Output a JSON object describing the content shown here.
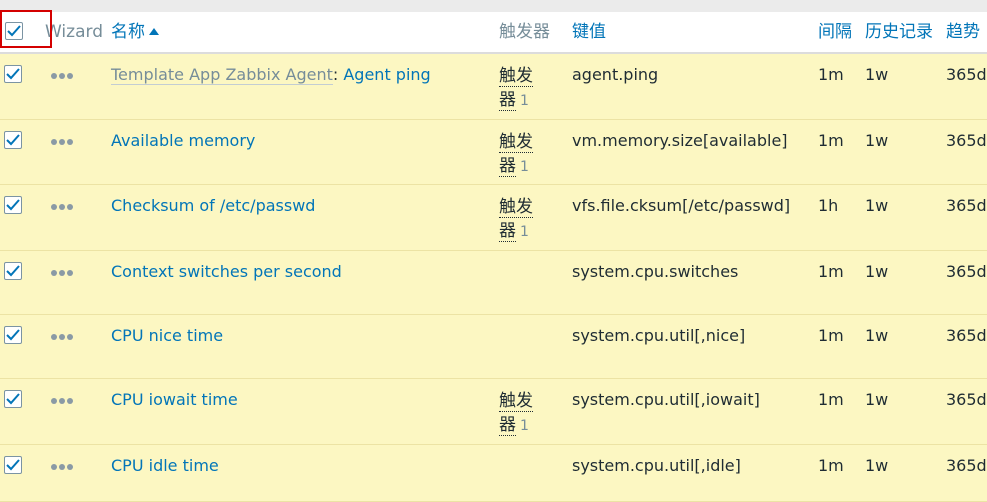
{
  "header": {
    "wizard": "Wizard",
    "name": "名称",
    "triggers": "触发器",
    "key": "键值",
    "interval": "间隔",
    "history": "历史记录",
    "trends": "趋势"
  },
  "rows": [
    {
      "template": "Template App Zabbix Agent",
      "separator": ":",
      "name": "Agent ping",
      "trigger_line1": "触发",
      "trigger_line2": "器",
      "trigger_count": "1",
      "key": "agent.ping",
      "interval": "1m",
      "history": "1w",
      "trends": "365d"
    },
    {
      "template": "",
      "separator": "",
      "name": "Available memory",
      "trigger_line1": "触发",
      "trigger_line2": "器",
      "trigger_count": "1",
      "key": "vm.memory.size[available]",
      "interval": "1m",
      "history": "1w",
      "trends": "365d"
    },
    {
      "template": "",
      "separator": "",
      "name": "Checksum of /etc/passwd",
      "trigger_line1": "触发",
      "trigger_line2": "器",
      "trigger_count": "1",
      "key": "vfs.file.cksum[/etc/passwd]",
      "interval": "1h",
      "history": "1w",
      "trends": "365d"
    },
    {
      "template": "",
      "separator": "",
      "name": "Context switches per second",
      "trigger_line1": "",
      "trigger_line2": "",
      "trigger_count": "",
      "key": "system.cpu.switches",
      "interval": "1m",
      "history": "1w",
      "trends": "365d"
    },
    {
      "template": "",
      "separator": "",
      "name": "CPU nice time",
      "trigger_line1": "",
      "trigger_line2": "",
      "trigger_count": "",
      "key": "system.cpu.util[,nice]",
      "interval": "1m",
      "history": "1w",
      "trends": "365d"
    },
    {
      "template": "",
      "separator": "",
      "name": "CPU iowait time",
      "trigger_line1": "触发",
      "trigger_line2": "器",
      "trigger_count": "1",
      "key": "system.cpu.util[,iowait]",
      "interval": "1m",
      "history": "1w",
      "trends": "365d"
    },
    {
      "template": "",
      "separator": "",
      "name": "CPU idle time",
      "trigger_line1": "",
      "trigger_line2": "",
      "trigger_count": "",
      "key": "system.cpu.util[,idle]",
      "interval": "1m",
      "history": "1w",
      "trends": "365d"
    }
  ]
}
